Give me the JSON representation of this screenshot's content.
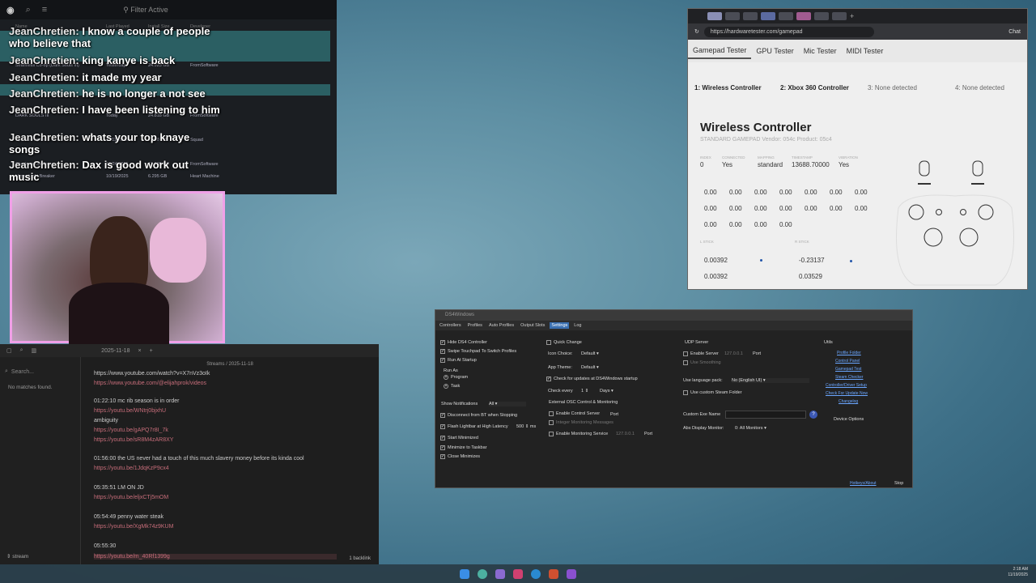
{
  "library": {
    "filter": "Filter Active",
    "headers": [
      "Name",
      "Last Played",
      "Install Size",
      "Developer"
    ],
    "rows": [
      {
        "name": "Seamless Co-op (Dark Souls III)",
        "played": "Yesterday",
        "size": "24.923 GB",
        "dev": "FromSoftware"
      },
      {
        "name": "DARK SOULS III",
        "played": "Today",
        "size": "24.818 GB",
        "dev": "FromSoftware"
      },
      {
        "name": "Space Program",
        "played": "11/11/2025",
        "size": "7.998 GB",
        "dev": "Squad"
      },
      {
        "name": "Shadows Die Twice",
        "played": "10/24/2025",
        "size": "13.939 GB",
        "dev": "FromSoftware"
      },
      {
        "name": "Hyper Light Breaker",
        "played": "10/19/2025",
        "size": "6.295 GB",
        "dev": "Heart Machine"
      }
    ]
  },
  "chat": [
    {
      "user": "JeanChretien:",
      "msg": "I know a couple of people who believe that"
    },
    {
      "user": "JeanChretien:",
      "msg": "king kanye is back"
    },
    {
      "user": "JeanChretien:",
      "msg": "it made my year"
    },
    {
      "user": "JeanChretien:",
      "msg": "he is no longer a not see"
    },
    {
      "user": "JeanChretien:",
      "msg": "I have been listening to him"
    },
    {
      "user": "JeanChretien:",
      "msg": "whats your top knaye songs"
    },
    {
      "user": "JeanChretien:",
      "msg": "Dax is good work out music"
    }
  ],
  "notes": {
    "date_tab": "2025-11-18",
    "breadcrumb": "Streams / 2025-11-18",
    "search_placeholder": "Search...",
    "no_matches": "No matches found.",
    "vault": "stream",
    "backlinks": "1 backlink",
    "lines": [
      {
        "text": "https://www.youtube.com/watch?v=X7nVz3oIk",
        "link": true
      },
      {
        "text": "https://www.youtube.com/@elijahprok/videos",
        "link": true
      },
      {
        "text": "01:22:10 mc rib season is in order",
        "link": false
      },
      {
        "text": "https://youtu.be/WNtrj0bjxhU",
        "link": true
      },
      {
        "text": "ambiguity",
        "link": false
      },
      {
        "text": "https://youtu.be/gAPQ7r8I_7k",
        "link": true
      },
      {
        "text": "https://youtu.be/sR8M4zAR8XY",
        "link": true
      },
      {
        "text": "01:56:00 the US never had a touch of this much slavery money before its kinda cool",
        "link": false
      },
      {
        "text": "https://youtu.be/1JdqKzP9cx4",
        "link": true
      },
      {
        "text": "05:35:51 LM ON JD",
        "link": false
      },
      {
        "text": "https://youtu.be/eljxCTj5mOM",
        "link": true
      },
      {
        "text": "05:54:49 penny water steak",
        "link": false
      },
      {
        "text": "https://youtu.be/XgMk74z9KUM",
        "link": true
      },
      {
        "text": "05:55:30",
        "link": false
      },
      {
        "text": "https://youtu.be/m_40Rf1399g",
        "link": true
      }
    ]
  },
  "browser": {
    "url": "https://hardwaretester.com/gamepad",
    "chat_label": "Chat",
    "nav": [
      "Gamepad Tester",
      "GPU Tester",
      "Mic Tester",
      "MIDI Tester"
    ],
    "slots": [
      "1: Wireless Controller",
      "2: Xbox 360 Controller",
      "3: None detected",
      "4: None detected"
    ],
    "device_title": "Wireless Controller",
    "device_sub": "STANDARD GAMEPAD Vendor: 054c Product: 05c4",
    "info_labels": [
      "INDEX",
      "CONNECTED",
      "MAPPING",
      "TIMESTAMP",
      "VIBRATION"
    ],
    "info_values": [
      "0",
      "Yes",
      "standard",
      "13688.70000",
      "Yes"
    ],
    "buttons": [
      "0.00",
      "0.00",
      "0.00",
      "0.00",
      "0.00",
      "0.00",
      "0.00",
      "0.00",
      "0.00",
      "0.00",
      "0.00",
      "0.00",
      "0.00",
      "0.00",
      "0.00",
      "0.00",
      "0.00",
      "0.00"
    ],
    "lstick_label": "L STICK",
    "rstick_label": "R STICK",
    "axes": [
      "0.00392",
      "0.00392",
      "-0.23137",
      "0.03529"
    ]
  },
  "ds4": {
    "title": "DS4Windows",
    "tabs": [
      "Controllers",
      "Profiles",
      "Auto Profiles",
      "Output Slots",
      "Settings",
      "Log"
    ],
    "left": [
      "Hide DS4 Controller",
      "Swipe Touchpad To Switch Profiles",
      "Run At Startup"
    ],
    "run_as": "Run As",
    "run_opts": [
      "Program",
      "Task"
    ],
    "show_notifications": "Show Notifications",
    "notif_value": "All",
    "left2": [
      "Disconnect from BT when Stopping",
      "Flash Lightbar at High Latency",
      "Start Minimized",
      "Minimize to Taskbar",
      "Close Minimizes"
    ],
    "latency_val": "500",
    "latency_unit": "ms",
    "quick_change": "Quick Change",
    "icon_choice": "Icon Choice:",
    "icon_val": "Default",
    "app_theme": "App Theme:",
    "theme_val": "Default",
    "check_updates": "Check for updates at DS4Windows startup",
    "check_every": "Check every",
    "check_every_val": "1",
    "days": "Days",
    "osc_title": "External OSC Control & Monitoring",
    "osc": [
      "Enable Control Server",
      "Integer Monitoring Messages",
      "Enable Monitoring Service"
    ],
    "port": "Port",
    "monitor_ip": "127.0.0.1",
    "udp_title": "UDP Server",
    "enable_server": "Enable Server",
    "server_ip": "127.0.0.1",
    "use_smoothing": "Use Smoothing",
    "lang_label": "Use language pack:",
    "lang_val": "No (English UI)",
    "custom_steam": "Use custom Steam Folder",
    "custom_exe": "Custom Exe Name",
    "abs_display": "Abs Display Monitor:",
    "abs_val": "0: All Monitors",
    "utils_title": "Utils",
    "utils": [
      "Profile Folder",
      "Control Panel",
      "Gamepad Test",
      "Steam Checker",
      "Controller/Driver Setup",
      "Check For Update Now",
      "Changelog"
    ],
    "device_options": "Device Options",
    "hotkeys": "Hotkeys/About",
    "stop": "Stop"
  },
  "clock": {
    "time": "2:18 AM",
    "date": "11/19/2025"
  }
}
